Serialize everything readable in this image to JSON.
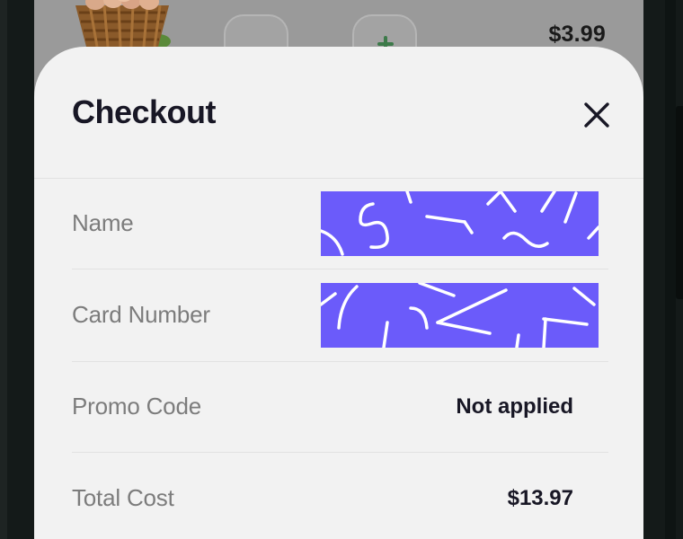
{
  "background_product": {
    "price": "$3.99",
    "image": "egg-basket-image",
    "decrease_icon": "minus-icon",
    "increase_icon": "plus-icon"
  },
  "checkout": {
    "title": "Checkout",
    "close_icon": "close-icon",
    "rows": [
      {
        "label": "Name",
        "value": "",
        "redacted": true
      },
      {
        "label": "Card Number",
        "value": "",
        "redacted": true
      },
      {
        "label": "Promo Code",
        "value": "Not applied",
        "redacted": false
      },
      {
        "label": "Total Cost",
        "value": "$13.97",
        "redacted": false
      }
    ]
  },
  "colors": {
    "sheet_background": "#f2f2f2",
    "title_text": "#181725",
    "label_text": "#7c7c7c",
    "redaction_fill": "#6b5bfa",
    "overlay_dim": "#9a9a9a"
  }
}
